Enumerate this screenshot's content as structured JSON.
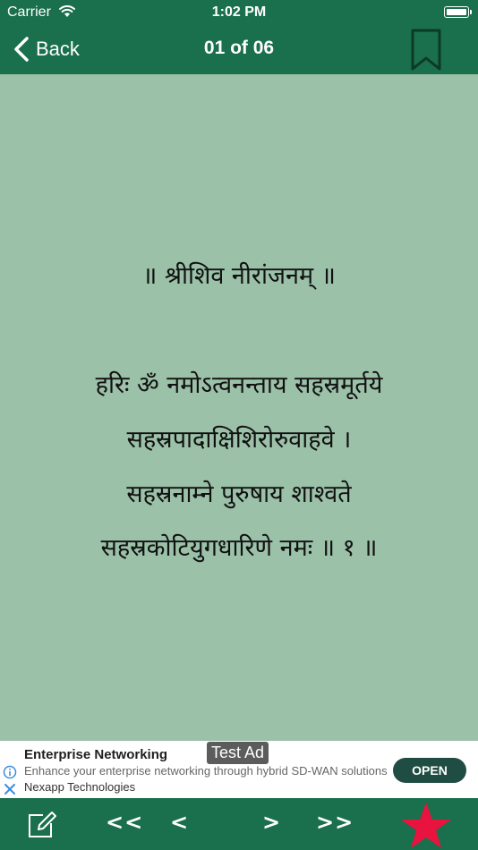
{
  "status_bar": {
    "carrier": "Carrier",
    "time": "1:02 PM"
  },
  "nav": {
    "back_label": "Back",
    "title": "01 of 06"
  },
  "content": {
    "title": "॥ श्रीशिव नीरांजनम् ॥",
    "lines": [
      "हरिः ॐ नमोऽत्वनन्ताय सहस्रमूर्तये",
      "सहस्रपादाक्षिशिरोरुवाहवे ।",
      "सहस्रनाम्ने पुरुषाय शाश्वते",
      "सहस्रकोटियुगधारिणे नमः ॥ १ ॥"
    ]
  },
  "ad": {
    "badge": "Test Ad",
    "headline": "Enterprise Networking",
    "description": "Enhance your enterprise networking through hybrid SD-WAN solutions",
    "advertiser": "Nexapp Technologies",
    "cta": "OPEN"
  },
  "toolbar": {
    "first": "<<",
    "prev": "<",
    "next": ">",
    "last": ">>"
  },
  "colors": {
    "bar": "#1a6f4c",
    "content_bg": "#9bc1a8",
    "star": "#e8133e",
    "ad_button": "#1f4d43"
  }
}
